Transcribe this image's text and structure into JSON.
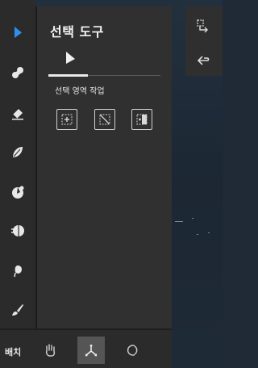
{
  "panel": {
    "title": "선택 도구",
    "section_label": "선택 영역 작업"
  },
  "bottom_bar": {
    "label": "배치"
  },
  "colors": {
    "accent": "#2f8ff0",
    "panel_bg": "#303030",
    "toolbar_bg": "#2b2b2b"
  },
  "icons": {
    "toolbar": [
      "select-arrow-icon",
      "smudge-icon",
      "eraser-icon",
      "leaf-brush-icon",
      "fill-icon",
      "shading-icon",
      "lasso-icon",
      "brush-icon"
    ],
    "actions": [
      "select-all-icon",
      "deselect-icon",
      "invert-selection-icon"
    ],
    "side": [
      "transform-icon",
      "back-icon"
    ],
    "bottom": [
      "hand-icon",
      "move-icon",
      "rotate-icon"
    ]
  }
}
